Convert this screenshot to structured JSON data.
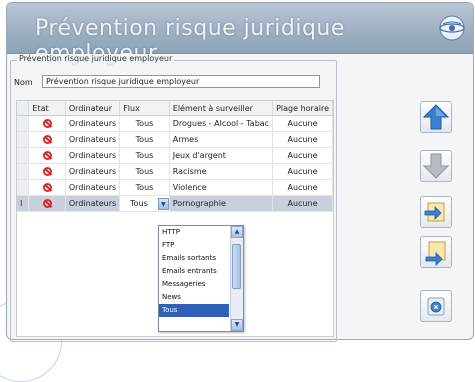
{
  "window": {
    "title": "Prévention risque juridique employeur"
  },
  "group": {
    "legend": "Prévention risque juridique employeur"
  },
  "name_field": {
    "label": "Nom",
    "value": "Prévention risque juridique employeur"
  },
  "table": {
    "headers": {
      "etat": "Etat",
      "ordinateur": "Ordinateur",
      "flux": "Flux",
      "element": "Elément à surveiller",
      "plage": "Plage horaire"
    },
    "rows": [
      {
        "marker": "",
        "ordinateur": "Ordinateurs",
        "flux": "Tous",
        "element": "Drogues - Alcool - Tabac",
        "plage": "Aucune"
      },
      {
        "marker": "",
        "ordinateur": "Ordinateurs",
        "flux": "Tous",
        "element": "Armes",
        "plage": "Aucune"
      },
      {
        "marker": "",
        "ordinateur": "Ordinateurs",
        "flux": "Tous",
        "element": "Jeux d'argent",
        "plage": "Aucune"
      },
      {
        "marker": "",
        "ordinateur": "Ordinateurs",
        "flux": "Tous",
        "element": "Racisme",
        "plage": "Aucune"
      },
      {
        "marker": "",
        "ordinateur": "Ordinateurs",
        "flux": "Tous",
        "element": "Violence",
        "plage": "Aucune"
      },
      {
        "marker": "I",
        "ordinateur": "Ordinateurs",
        "flux": "Tous",
        "element": "Pornographie",
        "plage": "Aucune"
      }
    ]
  },
  "flux_dropdown": {
    "options": [
      "HTTP",
      "FTP",
      "Emails sortants",
      "Emails entrants",
      "Messageries",
      "News",
      "Tous"
    ],
    "selected": "Tous"
  },
  "icons": {
    "row_state": "prohibited-icon",
    "side_buttons": [
      "arrow-up-icon",
      "arrow-down-icon",
      "add-rule-icon",
      "edit-rule-icon",
      "delete-rule-icon"
    ]
  },
  "colors": {
    "title_bar": "#9fb1c3",
    "selection": "#2f5fb8",
    "prohibited": "#d42a2a",
    "arrow_blue": "#3b7fd0"
  }
}
